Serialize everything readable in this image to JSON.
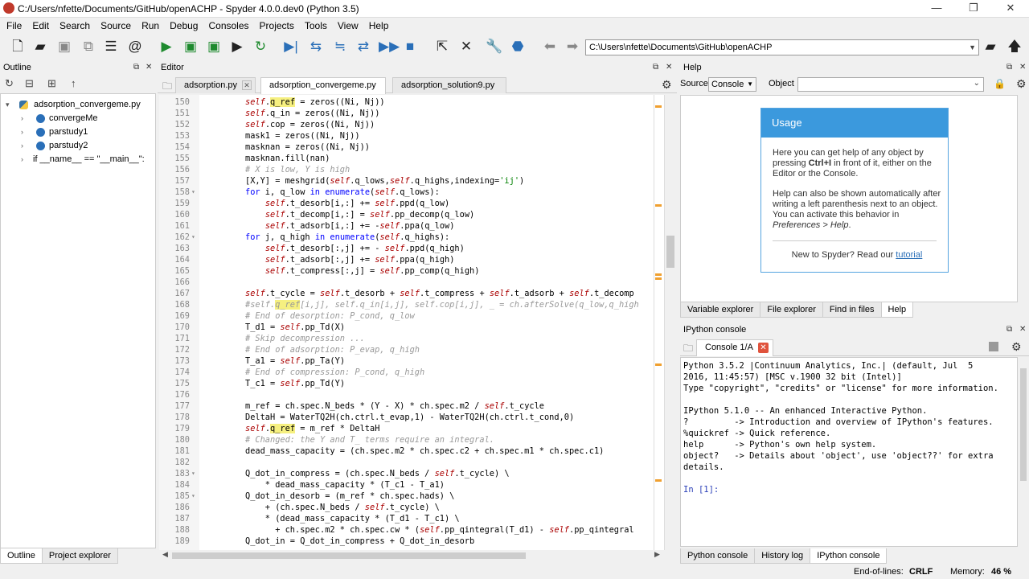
{
  "window": {
    "title": "C:/Users/nfette/Documents/GitHub/openACHP - Spyder 4.0.0.dev0 (Python 3.5)",
    "controls": [
      "—",
      "❐",
      "✕"
    ]
  },
  "menu": [
    "File",
    "Edit",
    "Search",
    "Source",
    "Run",
    "Debug",
    "Consoles",
    "Projects",
    "Tools",
    "View",
    "Help"
  ],
  "toolbar": {
    "path": "C:\\Users\\nfette\\Documents\\GitHub\\openACHP"
  },
  "outline": {
    "title": "Outline",
    "root": "adsorption_convergeme.py",
    "items": [
      "convergeMe",
      "parstudy1",
      "parstudy2",
      "if __name__ == \"__main__\":"
    ],
    "bottom_tabs": [
      "Outline",
      "Project explorer"
    ]
  },
  "editor": {
    "title": "Editor",
    "tabs": [
      "adsorption.py",
      "adsorption_convergeme.py",
      "adsorption_solution9.py"
    ]
  },
  "code": [
    {
      "n": "150",
      "fold": "",
      "segs": [
        [
          "i",
          "self"
        ],
        [
          "",
          "."
        ],
        [
          "h",
          "q_ref"
        ],
        [
          "",
          " = zeros((Ni, Nj))"
        ]
      ]
    },
    {
      "n": "151",
      "fold": "",
      "segs": [
        [
          "i",
          "self"
        ],
        [
          "",
          ".q_in = zeros((Ni, Nj))"
        ]
      ]
    },
    {
      "n": "152",
      "fold": "",
      "segs": [
        [
          "i",
          "self"
        ],
        [
          "",
          ".cop = zeros((Ni, Nj))"
        ]
      ]
    },
    {
      "n": "153",
      "fold": "",
      "segs": [
        [
          "",
          "mask1 = zeros((Ni, Nj))"
        ]
      ]
    },
    {
      "n": "154",
      "fold": "",
      "segs": [
        [
          "",
          "masknan = zeros((Ni, Nj))"
        ]
      ]
    },
    {
      "n": "155",
      "fold": "",
      "segs": [
        [
          "",
          "masknan.fill(nan)"
        ]
      ]
    },
    {
      "n": "156",
      "fold": "",
      "segs": [
        [
          "c",
          "# X is low, Y is high"
        ]
      ]
    },
    {
      "n": "157",
      "fold": "",
      "segs": [
        [
          "",
          "[X,Y] = meshgrid("
        ],
        [
          "i",
          "self"
        ],
        [
          "",
          ".q_lows,"
        ],
        [
          "i",
          "self"
        ],
        [
          "",
          ".q_highs,indexing="
        ],
        [
          "s",
          "'ij'"
        ],
        [
          "",
          ")"
        ]
      ]
    },
    {
      "n": "158",
      "fold": "▾",
      "segs": [
        [
          "k",
          "for"
        ],
        [
          "",
          " i, q_low "
        ],
        [
          "k",
          "in"
        ],
        [
          "",
          " "
        ],
        [
          "k",
          "enumerate"
        ],
        [
          "",
          "("
        ],
        [
          "i",
          "self"
        ],
        [
          "",
          ".q_lows):"
        ]
      ]
    },
    {
      "n": "159",
      "fold": "",
      "segs": [
        [
          "",
          "    "
        ],
        [
          "i",
          "self"
        ],
        [
          "",
          ".t_desorb[i,:] += "
        ],
        [
          "i",
          "self"
        ],
        [
          "",
          ".ppd(q_low)"
        ]
      ]
    },
    {
      "n": "160",
      "fold": "",
      "segs": [
        [
          "",
          "    "
        ],
        [
          "i",
          "self"
        ],
        [
          "",
          ".t_decomp[i,:] = "
        ],
        [
          "i",
          "self"
        ],
        [
          "",
          ".pp_decomp(q_low)"
        ]
      ]
    },
    {
      "n": "161",
      "fold": "",
      "segs": [
        [
          "",
          "    "
        ],
        [
          "i",
          "self"
        ],
        [
          "",
          ".t_adsorb[i,:] += -"
        ],
        [
          "i",
          "self"
        ],
        [
          "",
          ".ppa(q_low)"
        ]
      ]
    },
    {
      "n": "162",
      "fold": "▾",
      "segs": [
        [
          "k",
          "for"
        ],
        [
          "",
          " j, q_high "
        ],
        [
          "k",
          "in"
        ],
        [
          "",
          " "
        ],
        [
          "k",
          "enumerate"
        ],
        [
          "",
          "("
        ],
        [
          "i",
          "self"
        ],
        [
          "",
          ".q_highs):"
        ]
      ]
    },
    {
      "n": "163",
      "fold": "",
      "segs": [
        [
          "",
          "    "
        ],
        [
          "i",
          "self"
        ],
        [
          "",
          ".t_desorb[:,j] += - "
        ],
        [
          "i",
          "self"
        ],
        [
          "",
          ".ppd(q_high)"
        ]
      ]
    },
    {
      "n": "164",
      "fold": "",
      "segs": [
        [
          "",
          "    "
        ],
        [
          "i",
          "self"
        ],
        [
          "",
          ".t_adsorb[:,j] += "
        ],
        [
          "i",
          "self"
        ],
        [
          "",
          ".ppa(q_high)"
        ]
      ]
    },
    {
      "n": "165",
      "fold": "",
      "segs": [
        [
          "",
          "    "
        ],
        [
          "i",
          "self"
        ],
        [
          "",
          ".t_compress[:,j] = "
        ],
        [
          "i",
          "self"
        ],
        [
          "",
          ".pp_comp(q_high)"
        ]
      ]
    },
    {
      "n": "166",
      "fold": "",
      "segs": []
    },
    {
      "n": "167",
      "fold": "",
      "segs": [
        [
          "i",
          "self"
        ],
        [
          "",
          ".t_cycle = "
        ],
        [
          "i",
          "self"
        ],
        [
          "",
          ".t_desorb + "
        ],
        [
          "i",
          "self"
        ],
        [
          "",
          ".t_compress + "
        ],
        [
          "i",
          "self"
        ],
        [
          "",
          ".t_adsorb + "
        ],
        [
          "i",
          "self"
        ],
        [
          "",
          ".t_decomp"
        ]
      ]
    },
    {
      "n": "168",
      "fold": "",
      "segs": [
        [
          "c",
          "#self."
        ],
        [
          "hc",
          "q_ref"
        ],
        [
          "c",
          "[i,j], self.q_in[i,j], self.cop[i,j], _ = ch.afterSolve(q_low,q_high"
        ]
      ]
    },
    {
      "n": "169",
      "fold": "",
      "segs": [
        [
          "c",
          "# End of desorption: P_cond, q_low"
        ]
      ]
    },
    {
      "n": "170",
      "fold": "",
      "segs": [
        [
          "",
          "T_d1 = "
        ],
        [
          "i",
          "self"
        ],
        [
          "",
          ".pp_Td(X)"
        ]
      ]
    },
    {
      "n": "171",
      "fold": "",
      "segs": [
        [
          "c",
          "# Skip decompression ..."
        ]
      ]
    },
    {
      "n": "172",
      "fold": "",
      "segs": [
        [
          "c",
          "# End of adsorption: P_evap, q_high"
        ]
      ]
    },
    {
      "n": "173",
      "fold": "",
      "segs": [
        [
          "",
          "T_a1 = "
        ],
        [
          "i",
          "self"
        ],
        [
          "",
          ".pp_Ta(Y)"
        ]
      ]
    },
    {
      "n": "174",
      "fold": "",
      "segs": [
        [
          "c",
          "# End of compression: P_cond, q_high"
        ]
      ]
    },
    {
      "n": "175",
      "fold": "",
      "segs": [
        [
          "",
          "T_c1 = "
        ],
        [
          "i",
          "self"
        ],
        [
          "",
          ".pp_Td(Y)"
        ]
      ]
    },
    {
      "n": "176",
      "fold": "",
      "segs": []
    },
    {
      "n": "177",
      "fold": "",
      "segs": [
        [
          "",
          "m_ref = ch.spec.N_beds * (Y - X) * ch.spec.m2 / "
        ],
        [
          "i",
          "self"
        ],
        [
          "",
          ".t_cycle"
        ]
      ]
    },
    {
      "n": "178",
      "fold": "",
      "segs": [
        [
          "",
          "DeltaH = WaterTQ2H(ch.ctrl.t_evap,1) - WaterTQ2H(ch.ctrl.t_cond,0)"
        ]
      ]
    },
    {
      "n": "179",
      "fold": "",
      "segs": [
        [
          "i",
          "self"
        ],
        [
          "",
          "."
        ],
        [
          "h",
          "q_ref"
        ],
        [
          "",
          " = m_ref * DeltaH"
        ]
      ]
    },
    {
      "n": "180",
      "fold": "",
      "segs": [
        [
          "c",
          "# Changed: the Y and T_ terms require an integral."
        ]
      ]
    },
    {
      "n": "181",
      "fold": "",
      "segs": [
        [
          "",
          "dead_mass_capacity = (ch.spec.m2 * ch.spec.c2 + ch.spec.m1 * ch.spec.c1)"
        ]
      ]
    },
    {
      "n": "182",
      "fold": "",
      "segs": []
    },
    {
      "n": "183",
      "fold": "▾",
      "segs": [
        [
          "",
          "Q_dot_in_compress = (ch.spec.N_beds / "
        ],
        [
          "i",
          "self"
        ],
        [
          "",
          ".t_cycle) \\"
        ]
      ]
    },
    {
      "n": "184",
      "fold": "",
      "segs": [
        [
          "",
          "    * dead_mass_capacity * (T_c1 - T_a1)"
        ]
      ]
    },
    {
      "n": "185",
      "fold": "▾",
      "segs": [
        [
          "",
          "Q_dot_in_desorb = (m_ref * ch.spec.hads) \\"
        ]
      ]
    },
    {
      "n": "186",
      "fold": "",
      "segs": [
        [
          "",
          "    + (ch.spec.N_beds / "
        ],
        [
          "i",
          "self"
        ],
        [
          "",
          ".t_cycle) \\"
        ]
      ]
    },
    {
      "n": "187",
      "fold": "",
      "segs": [
        [
          "",
          "    * (dead_mass_capacity * (T_d1 - T_c1) \\"
        ]
      ]
    },
    {
      "n": "188",
      "fold": "",
      "segs": [
        [
          "",
          "      + ch.spec.m2 * ch.spec.cw * ("
        ],
        [
          "i",
          "self"
        ],
        [
          "",
          ".pp_qintegral(T_d1) - "
        ],
        [
          "i",
          "self"
        ],
        [
          "",
          ".pp_qintegral"
        ]
      ]
    },
    {
      "n": "189",
      "fold": "",
      "segs": [
        [
          "",
          "Q_dot_in = Q_dot_in_compress + Q_dot_in_desorb"
        ]
      ]
    }
  ],
  "help": {
    "title": "Help",
    "source_label": "Source",
    "source_value": "Console",
    "object_label": "Object",
    "usage_title": "Usage",
    "para1_a": "Here you can get help of any object by pressing ",
    "para1_key": "Ctrl+I",
    "para1_b": " in front of it, either on the Editor or the Console.",
    "para2_a": "Help can also be shown automatically after writing a left parenthesis next to an object. You can activate this behavior in ",
    "para2_pref": "Preferences > Help",
    "para2_b": ".",
    "new_text": "New to Spyder? Read our ",
    "tutorial_link": "tutorial",
    "tabs": [
      "Variable explorer",
      "File explorer",
      "Find in files",
      "Help"
    ]
  },
  "console": {
    "title": "IPython console",
    "tab": "Console 1/A",
    "lines": [
      "Python 3.5.2 |Continuum Analytics, Inc.| (default, Jul  5",
      "2016, 11:45:57) [MSC v.1900 32 bit (Intel)]",
      "Type \"copyright\", \"credits\" or \"license\" for more information.",
      "",
      "IPython 5.1.0 -- An enhanced Interactive Python.",
      "?         -> Introduction and overview of IPython's features.",
      "%quickref -> Quick reference.",
      "help      -> Python's own help system.",
      "object?   -> Details about 'object', use 'object??' for extra",
      "details.",
      "",
      "In [1]:"
    ],
    "bottom_tabs": [
      "Python console",
      "History log",
      "IPython console"
    ]
  },
  "status": {
    "eol_label": "End-of-lines:",
    "eol_value": "CRLF",
    "mem_label": "Memory:",
    "mem_value": "46 %"
  },
  "colors": {
    "keyword": "#0000ff",
    "self": "#aa0000",
    "comment": "#999999",
    "string": "#008000",
    "highlight": "#f6f080",
    "usage_header": "#3b99dd"
  }
}
